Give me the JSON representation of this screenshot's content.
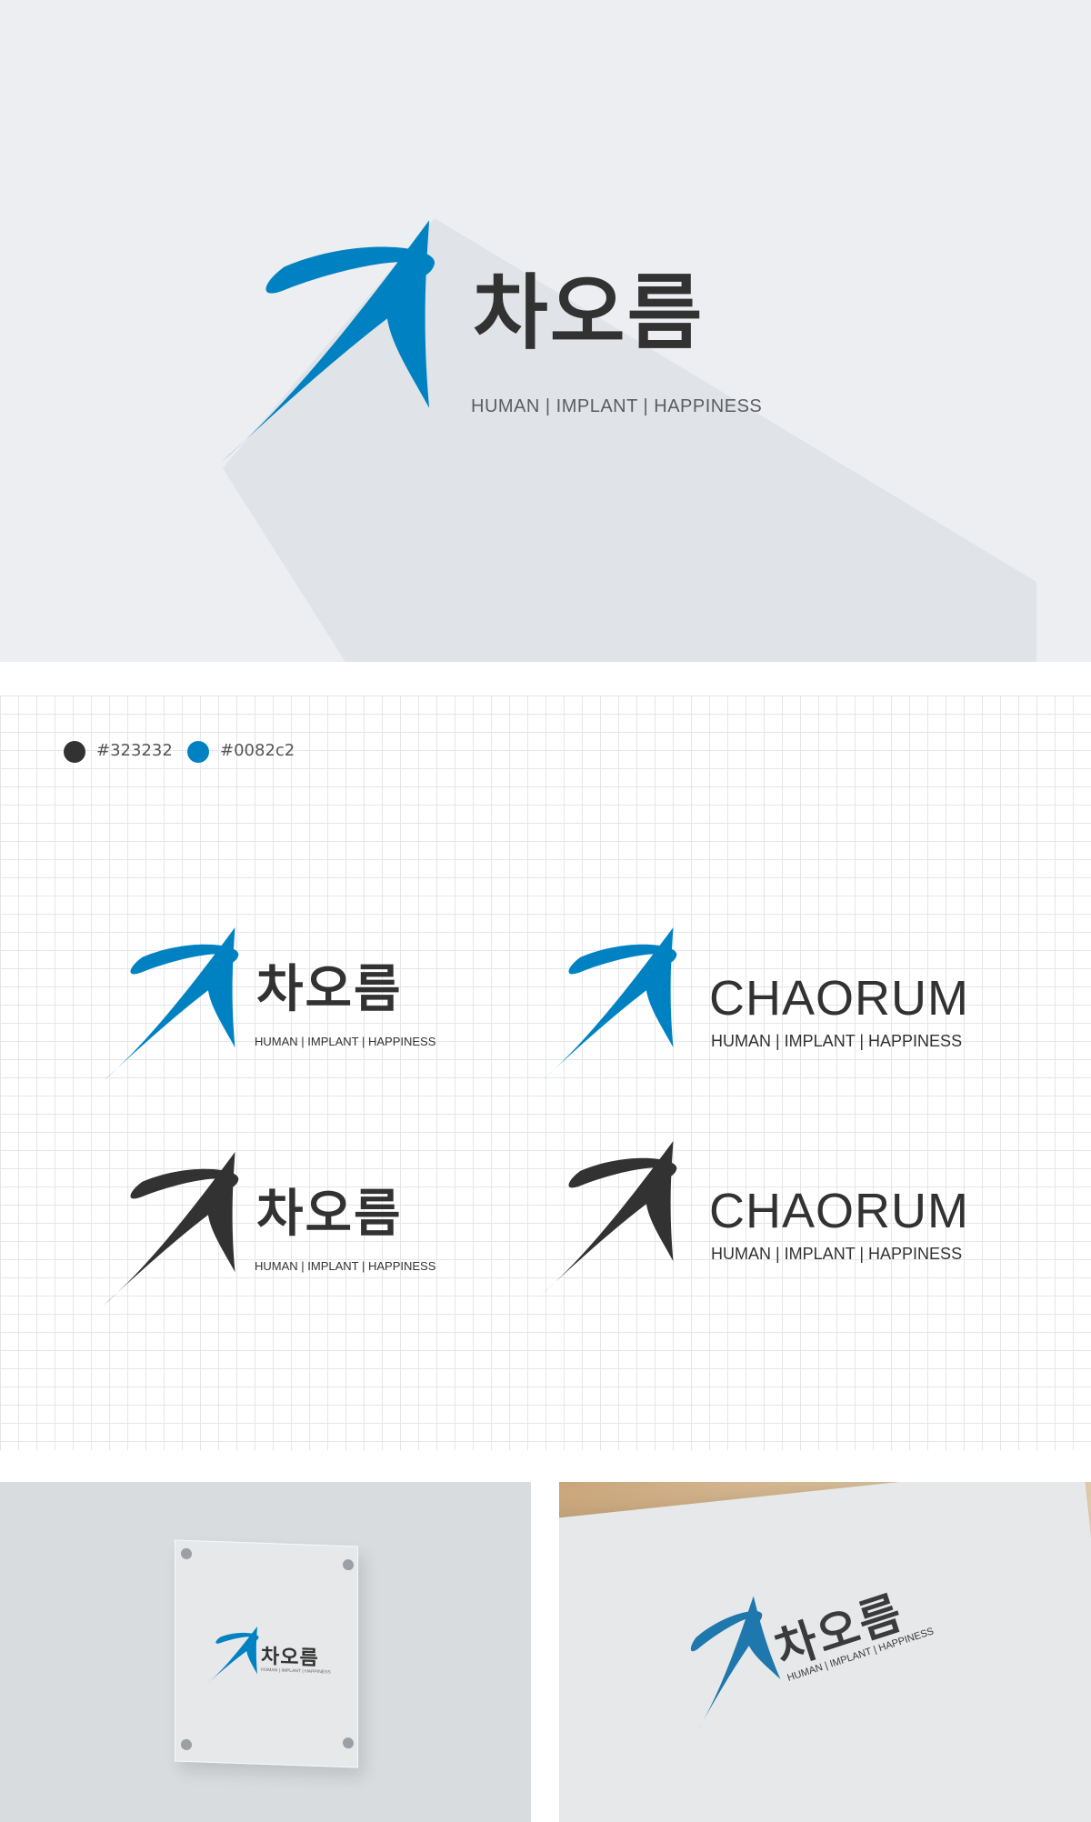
{
  "brand": {
    "korean_name": "차오름",
    "english_name": "CHAORUM",
    "tagline": "HUMAN | IMPLANT | HAPPINESS"
  },
  "palette": [
    {
      "hex": "#323232",
      "label": "#323232"
    },
    {
      "hex": "#0082c2",
      "label": "#0082c2"
    }
  ],
  "colors": {
    "dark": "#323232",
    "blue": "#0082c2",
    "hero_background": "#eceef1"
  },
  "variations": [
    {
      "style": "color",
      "wordmark": "korean"
    },
    {
      "style": "color",
      "wordmark": "english"
    },
    {
      "style": "mono-dark",
      "wordmark": "korean"
    },
    {
      "style": "mono-dark",
      "wordmark": "english"
    }
  ],
  "mockups": [
    {
      "type": "acrylic-wall-sign"
    },
    {
      "type": "embossed-paper"
    }
  ]
}
